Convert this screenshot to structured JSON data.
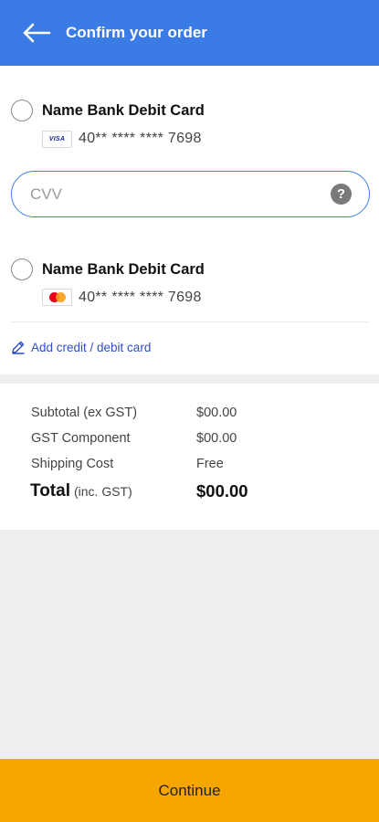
{
  "header": {
    "title": "Confirm your order"
  },
  "payment": {
    "cards": [
      {
        "name": "Name Bank Debit Card",
        "brand": "visa",
        "brand_text": "VISA",
        "number": "40** **** **** 7698",
        "selected": false
      },
      {
        "name": "Name Bank Debit Card",
        "brand": "mastercard",
        "number": "40** **** **** 7698",
        "selected": false
      }
    ],
    "cvv_placeholder": "CVV",
    "cvv_value": "",
    "help_glyph": "?",
    "add_card_label": "Add credit / debit card"
  },
  "summary": {
    "subtotal_label": "Subtotal (ex GST)",
    "subtotal_value": "$00.00",
    "gst_label": "GST Component",
    "gst_value": "$00.00",
    "shipping_label": "Shipping Cost",
    "shipping_value": "Free",
    "total_label": "Total",
    "total_sublabel": "(inc. GST)",
    "total_value": "$00.00"
  },
  "footer": {
    "continue_label": "Continue"
  },
  "colors": {
    "header_bg": "#3b7be6",
    "accent_blue": "#3b7be6",
    "link_blue": "#2f4ec4",
    "continue_bg": "#f7a500",
    "page_bg": "#eeeeee"
  },
  "icons": {
    "back": "arrow-left-icon",
    "help": "question-circle-icon",
    "add_card": "pencil-icon",
    "visa": "visa-logo-icon",
    "mastercard": "mastercard-logo-icon"
  }
}
